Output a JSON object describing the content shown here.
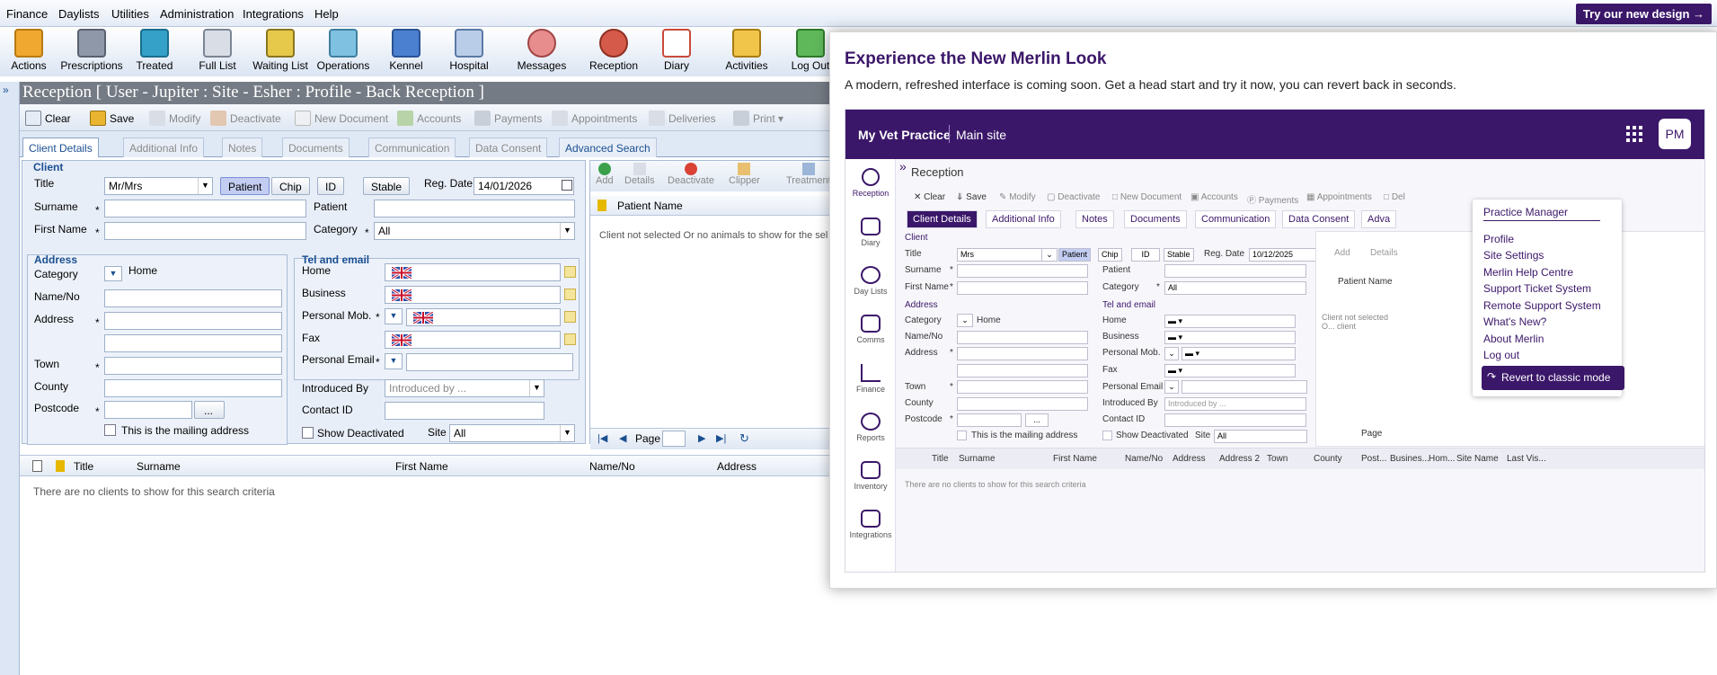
{
  "menu": {
    "items": [
      "Finance",
      "Daylists",
      "Utilities",
      "Administration",
      "Integrations",
      "Help"
    ],
    "try_label": "Try our new design →"
  },
  "toolbar": {
    "items": [
      "Actions",
      "Prescriptions",
      "Treated",
      "Full List",
      "Waiting List",
      "Operations",
      "Kennel",
      "Hospital",
      "Messages",
      "Reception",
      "Diary",
      "Activities",
      "Log Out"
    ]
  },
  "page_title": "Reception [ User - Jupiter : Site - Esher : Profile - Back Reception ]",
  "actions": [
    "Clear",
    "Save",
    "Modify",
    "Deactivate",
    "New Document",
    "Accounts",
    "Payments",
    "Appointments",
    "Deliveries",
    "Print"
  ],
  "tabs": [
    "Client Details",
    "Additional Info",
    "Notes",
    "Documents",
    "Communication",
    "Data Consent",
    "Advanced Search"
  ],
  "client": {
    "section": "Client",
    "title_label": "Title",
    "title_value": "Mr/Mrs",
    "type_buttons": [
      "Patient",
      "Chip",
      "ID",
      "Stable"
    ],
    "reg_date_label": "Reg. Date",
    "reg_date_value": "14/01/2026",
    "surname_label": "Surname",
    "first_name_label": "First Name",
    "patient_label": "Patient",
    "category_label": "Category",
    "category_value": "All"
  },
  "address": {
    "section": "Address",
    "category_label": "Category",
    "category_value": "Home",
    "name_no_label": "Name/No",
    "address_label": "Address",
    "town_label": "Town",
    "county_label": "County",
    "postcode_label": "Postcode",
    "lookup_label": "...",
    "mailing_label": "This is the mailing address"
  },
  "tel": {
    "section": "Tel and email",
    "home_label": "Home",
    "business_label": "Business",
    "mobile_label": "Personal Mob.",
    "fax_label": "Fax",
    "email_label": "Personal Email",
    "introduced_label": "Introduced By",
    "introduced_placeholder": "Introduced by ...",
    "contact_label": "Contact ID",
    "show_deactivated_label": "Show Deactivated",
    "site_label": "Site",
    "site_value": "All"
  },
  "patient_panel": {
    "buttons": [
      "Add",
      "Details",
      "Deactivate",
      "Clipper",
      "Treatment"
    ],
    "header": "Patient Name",
    "empty_text": "Client not selected Or no animals to show for the sel",
    "page_label": "Page"
  },
  "grid": {
    "columns": [
      "Title",
      "Surname",
      "First Name",
      "Name/No",
      "Address"
    ],
    "empty_text": "There are no clients to show for this search criteria"
  },
  "overlay": {
    "title": "Experience the New Merlin Look",
    "subtitle": "A modern, refreshed interface is coming soon. Get a head start and try it now, you can revert back in seconds.",
    "preview": {
      "brand": "My Vet Practice",
      "site": "Main site",
      "avatar": "PM",
      "heading": "Reception",
      "side_items": [
        "Reception",
        "Diary",
        "Day Lists",
        "Comms",
        "Finance",
        "Reports",
        "Inventory",
        "Integrations"
      ],
      "actions": [
        "Clear",
        "Save",
        "Modify",
        "Deactivate",
        "New Document",
        "Accounts",
        "Payments",
        "Appointments",
        "Del"
      ],
      "tabs": [
        "Client Details",
        "Additional Info",
        "Notes",
        "Documents",
        "Communication",
        "Data Consent",
        "Adva"
      ],
      "client_section": "Client",
      "title_label": "Title",
      "title_value": "Mrs",
      "type_buttons": [
        "Patient",
        "Chip",
        "ID",
        "Stable"
      ],
      "reg_date_label": "Reg. Date",
      "reg_date_value": "10/12/2025",
      "surname_label": "Surname",
      "first_name_label": "First Name",
      "patient_label": "Patient",
      "category_label": "Category",
      "category_value": "All",
      "address_section": "Address",
      "addr_category_label": "Category",
      "addr_category_value": "Home",
      "name_no_label": "Name/No",
      "address_label": "Address",
      "town_label": "Town",
      "county_label": "County",
      "postcode_label": "Postcode",
      "lookup_label": "...",
      "mailing_label": "This is the mailing address",
      "tel_section": "Tel and email",
      "home_label": "Home",
      "business_label": "Business",
      "mobile_label": "Personal Mob.",
      "fax_label": "Fax",
      "email_label": "Personal Email",
      "introduced_label": "Introduced By",
      "introduced_placeholder": "Introduced by ...",
      "contact_label": "Contact ID",
      "show_deactivated_label": "Show Deactivated",
      "site_label": "Site",
      "site_value": "All",
      "patient_buttons": [
        "Add",
        "Details"
      ],
      "patient_header": "Patient Name",
      "patient_empty": "Client not selected O... client",
      "page_label": "Page",
      "grid_columns": [
        "Title",
        "Surname",
        "First Name",
        "Name/No",
        "Address",
        "Address 2",
        "Town",
        "County",
        "Post...",
        "Busines...",
        "Hom...",
        "Site Name",
        "Last Vis..."
      ],
      "grid_empty": "There are no clients to show for this search criteria"
    },
    "menu": {
      "heading": "Practice Manager",
      "items": [
        "Profile",
        "Site Settings",
        "Merlin Help Centre",
        "Support Ticket System",
        "Remote Support System",
        "What's New?",
        "About Merlin",
        "Log out"
      ],
      "revert_label": "Revert to classic mode"
    }
  },
  "colors": {
    "brand_purple": "#3b1769",
    "classic_blue": "#1b4f91",
    "title_bar_gray": "#757b84"
  }
}
